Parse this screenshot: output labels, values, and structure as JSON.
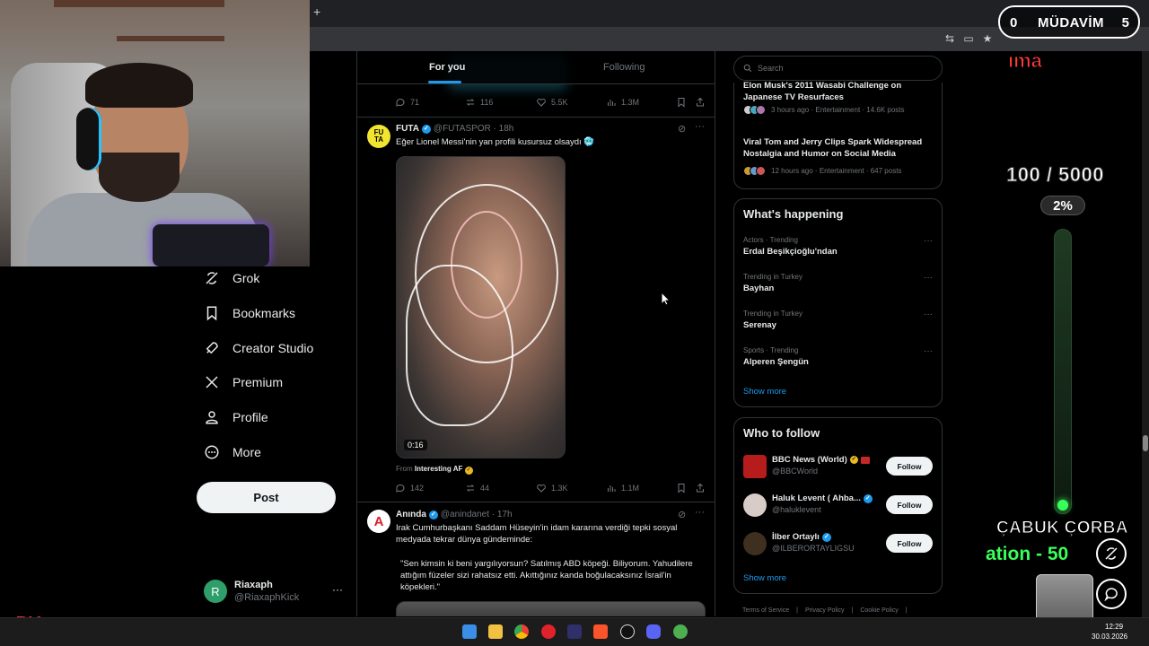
{
  "stream": {
    "counter_left": "0",
    "counter_label": "MÜDAVİM",
    "counter_right": "5",
    "top_text": "ıma",
    "goal": "100 / 5000",
    "goal_pct": "2%",
    "goal_fraction": 0.02,
    "sponsor_line": "ÇABUK ÇORBA",
    "donation_line": "ation - 50",
    "logo_text": "BY"
  },
  "feed": {
    "tabs": [
      "For you",
      "Following"
    ],
    "top_post_actions": {
      "replies": "71",
      "reposts": "116",
      "likes": "5.5K",
      "views": "1.3M"
    },
    "posts": [
      {
        "name": "FUTA",
        "handle": "@FUTASPOR · 18h",
        "avatar_text": "FU\nTA",
        "text": "Eğer Lionel Messi'nin yan profili kusursuz olsaydı 🥶",
        "video_time": "0:16",
        "from_label": "From",
        "from_source": "Interesting AF",
        "actions": {
          "replies": "142",
          "reposts": "44",
          "likes": "1.3K",
          "views": "1.1M"
        }
      },
      {
        "name": "Anında",
        "handle": "@anindanet · 17h",
        "avatar_text": "A",
        "text_1": "Irak Cumhurbaşkanı Saddam Hüseyin'in idam kararına verdiği tepki sosyal medyada tekrar dünya gündeminde:",
        "text_2": "\"Sen kimsin ki beni yargılıyorsun? Satılmış ABD köpeği. Biliyorum. Yahudilere attığım füzeler sizi rahatsız etti. Akıttığınız kanda boğulacaksınız İsrail'in köpekleri.\""
      }
    ]
  },
  "sidebar": {
    "items": [
      {
        "label": "Grok",
        "icon": "grok-icon"
      },
      {
        "label": "Bookmarks",
        "icon": "bookmark-icon"
      },
      {
        "label": "Creator Studio",
        "icon": "rocket-icon"
      },
      {
        "label": "Premium",
        "icon": "x-logo-icon"
      },
      {
        "label": "Profile",
        "icon": "person-icon"
      },
      {
        "label": "More",
        "icon": "more-circle-icon"
      }
    ],
    "post_button": "Post",
    "user": {
      "initial": "R",
      "name": "Riaxaph",
      "handle": "@RiaxaphKick",
      "more": "···"
    }
  },
  "right": {
    "search_placeholder": "Search",
    "top_trends": [
      {
        "title": "Elon Musk's 2011 Wasabi Challenge on Japanese TV Resurfaces",
        "meta": "3 hours ago · Entertainment · 14.6K posts"
      },
      {
        "title": "Viral Tom and Jerry Clips Spark Widespread Nostalgia and Humor on Social Media",
        "meta": "12 hours ago · Entertainment · 647 posts"
      }
    ],
    "whats_happening": {
      "heading": "What's happening",
      "items": [
        {
          "context": "Actors · Trending",
          "name": "Erdal Beşikçioğlu'ndan"
        },
        {
          "context": "Trending in Turkey",
          "name": "Bayhan"
        },
        {
          "context": "Trending in Turkey",
          "name": "Serenay"
        },
        {
          "context": "Sports · Trending",
          "name": "Alperen Şengün"
        }
      ],
      "show_more": "Show more"
    },
    "who_to_follow": {
      "heading": "Who to follow",
      "accounts": [
        {
          "name": "BBC News (World)",
          "handle": "@BBCWorld",
          "button": "Follow"
        },
        {
          "name": "Haluk Levent ( Ahba...",
          "handle": "@haluklevent",
          "button": "Follow"
        },
        {
          "name": "İlber Ortaylı",
          "handle": "@ILBERORTAYLIGSU",
          "button": "Follow"
        }
      ],
      "show_more": "Show more"
    },
    "footer": [
      "Terms of Service",
      "|",
      "Privacy Policy",
      "|",
      "Cookie Policy",
      "|"
    ]
  },
  "taskbar": {
    "time": "12:29",
    "date": "30.03.2026"
  }
}
